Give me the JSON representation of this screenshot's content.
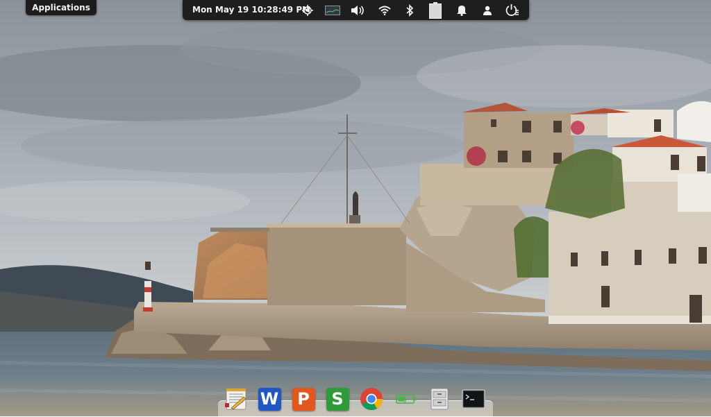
{
  "applications_label": "Applications",
  "top_panel": {
    "clock": "Mon May 19 10:28:49 PM",
    "indicators": [
      "location-icon",
      "monitor-graph-icon",
      "volume-icon",
      "wifi-icon",
      "bluetooth-icon",
      "battery-icon",
      "notifications-bell-icon",
      "user-icon",
      "power-session-icon"
    ]
  },
  "dock": {
    "items": [
      {
        "icon": "text-editor-icon"
      },
      {
        "icon": "wps-writer-icon",
        "letter": "W",
        "color": "#1f57c4"
      },
      {
        "icon": "wps-presentation-icon",
        "letter": "P",
        "color": "#e2571e"
      },
      {
        "icon": "wps-spreadsheets-icon",
        "letter": "S",
        "color": "#2f9a3a"
      },
      {
        "icon": "chrome-icon"
      },
      {
        "icon": "battery-monitor-icon"
      },
      {
        "icon": "file-manager-icon"
      },
      {
        "icon": "terminal-icon"
      }
    ]
  },
  "colors": {
    "panel_bg": "#1e1e1e",
    "panel_text": "#f2f2f2"
  }
}
